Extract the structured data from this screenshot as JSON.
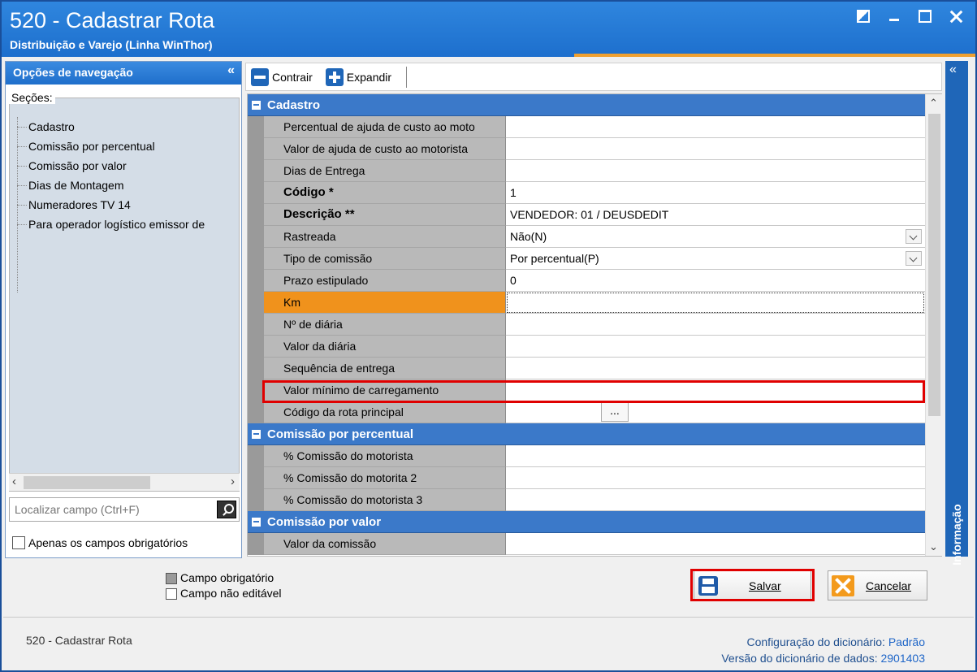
{
  "window": {
    "title": "520 - Cadastrar Rota",
    "subtitle": "Distribuição e Varejo (Linha WinThor)"
  },
  "nav": {
    "header": "Opções de navegação",
    "collapse": "«",
    "sections_label": "Seções:",
    "items": [
      "Cadastro",
      "Comissão por percentual",
      "Comissão por valor",
      "Dias de Montagem",
      "Numeradores TV 14",
      "Para operador logístico emissor de"
    ],
    "search_placeholder": "Localizar campo (Ctrl+F)",
    "only_required_label": "Apenas os campos obrigatórios"
  },
  "toolbar": {
    "collapse_label": "Contrair",
    "expand_label": "Expandir"
  },
  "grid": {
    "categories": [
      {
        "name": "Cadastro",
        "rows": [
          {
            "label": "Percentual de ajuda de custo ao moto",
            "value": ""
          },
          {
            "label": "Valor de ajuda de custo ao motorista",
            "value": ""
          },
          {
            "label": "Dias de Entrega",
            "value": ""
          },
          {
            "label": "Código *",
            "value": "1"
          },
          {
            "label": "Descrição **",
            "value": "VENDEDOR: 01 / DEUSDEDIT"
          },
          {
            "label": "Rastreada",
            "value": "Não(N)"
          },
          {
            "label": "Tipo de comissão",
            "value": "Por percentual(P)"
          },
          {
            "label": "Prazo estipulado",
            "value": "0"
          },
          {
            "label": "Km",
            "value": ""
          },
          {
            "label": "Nº de diária",
            "value": ""
          },
          {
            "label": "Valor da diária",
            "value": ""
          },
          {
            "label": "Sequência de entrega",
            "value": ""
          },
          {
            "label": "Valor mínimo de carregamento",
            "value": ""
          },
          {
            "label": "Código da rota principal",
            "value": "",
            "button": "..."
          }
        ]
      },
      {
        "name": "Comissão por percentual",
        "rows": [
          {
            "label": "% Comissão do motorista",
            "value": ""
          },
          {
            "label": "% Comissão do motorita 2",
            "value": ""
          },
          {
            "label": "% Comissão do motorista 3",
            "value": ""
          }
        ]
      },
      {
        "name": "Comissão por valor",
        "rows": [
          {
            "label": "Valor da comissão",
            "value": ""
          }
        ]
      }
    ]
  },
  "info_panel": {
    "label": "Informação",
    "collapse": "«"
  },
  "legend": {
    "required": "Campo obrigatório",
    "not_editable": "Campo não editável"
  },
  "actions": {
    "save": "Salvar",
    "cancel": "Cancelar"
  },
  "status": {
    "left": "520 - Cadastrar Rota",
    "dict_config_label": "Configuração do dicionário:",
    "dict_config_value": "Padrão",
    "dict_version_label": "Versão do dicionário de dados:",
    "dict_version_value": "2901403"
  },
  "colors": {
    "title_bar": "#1d6fcd",
    "category_header": "#3b79c9",
    "active_field": "#f0921c",
    "highlight": "#e00000"
  }
}
